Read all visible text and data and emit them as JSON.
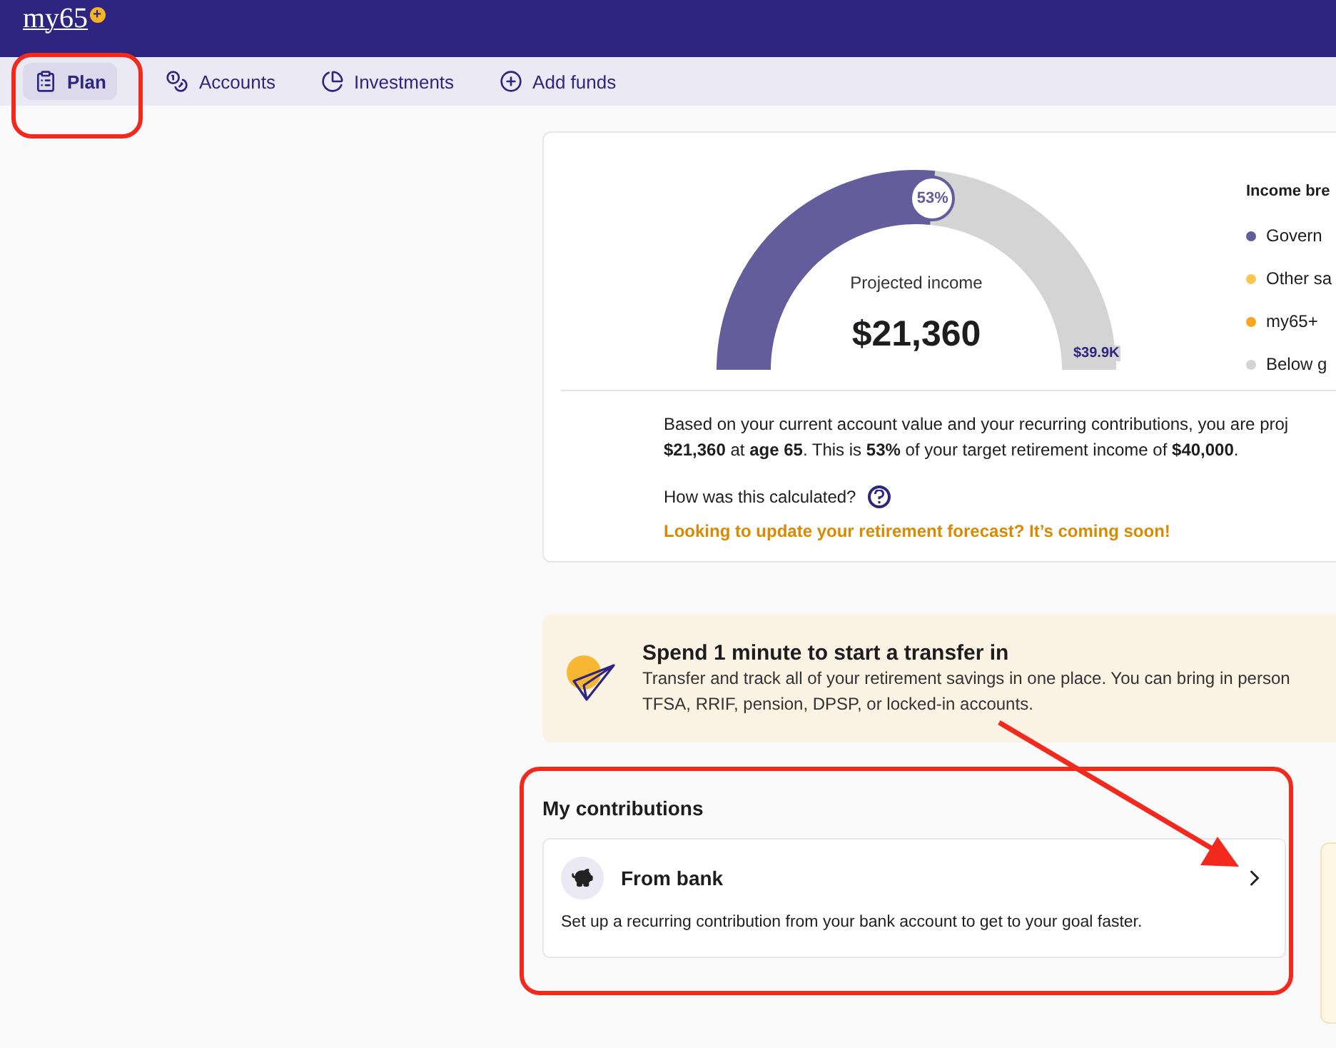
{
  "logo": {
    "text": "my65",
    "badge": "+"
  },
  "nav": [
    {
      "label": "Plan",
      "selected": true
    },
    {
      "label": "Accounts",
      "selected": false
    },
    {
      "label": "Investments",
      "selected": false
    },
    {
      "label": "Add funds",
      "selected": false
    }
  ],
  "projection": {
    "gauge_label": "Projected income",
    "amount": "$21,360",
    "percent": "53%",
    "max_label": "$39.9K",
    "legend_title": "Income bre",
    "legend": [
      {
        "label": "Govern",
        "color": "#635d9c"
      },
      {
        "label": "Other sa",
        "color": "#f9c74f"
      },
      {
        "label": "my65+",
        "color": "#f5a623"
      },
      {
        "label": "Below g",
        "color": "#d4d4d4"
      }
    ],
    "summary": [
      "Based on your current account value and your recurring contributions, you are proj",
      "**$21,360** at **age 65**. This is **53%** of your target retirement income of **$40,000**."
    ],
    "help_question": "How was this calculated?",
    "notice": "Looking to update your retirement forecast? It’s coming soon!"
  },
  "transfer_banner": {
    "title": "Spend 1 minute to start a transfer in",
    "lines": [
      "Transfer and track all of your retirement savings in one place. You can bring in person",
      "TFSA, RRIF, pension, DPSP, or locked-in accounts."
    ]
  },
  "contributions": {
    "title": "My contributions",
    "items": [
      {
        "title": "From bank",
        "description": "Set up a recurring contribution from your bank account to get to your goal faster."
      }
    ]
  },
  "annotations": [
    {
      "kind": "frame"
    },
    {
      "kind": "frame"
    },
    {
      "kind": "arrow"
    }
  ]
}
